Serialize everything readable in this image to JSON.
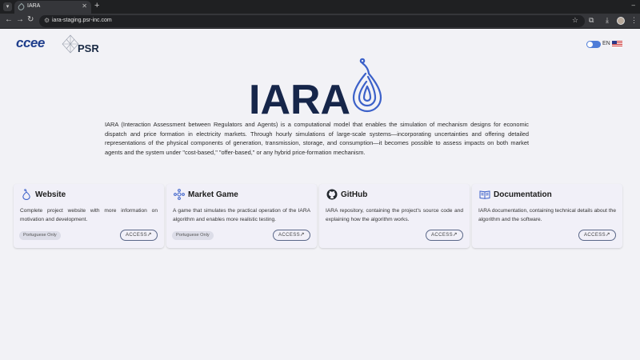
{
  "browser": {
    "tab_title": "IARA",
    "url": "iara-staging.psr-inc.com",
    "tab_close": "✕",
    "new_tab": "+",
    "menu": "⋮"
  },
  "header": {
    "ccee_logo": "ccee",
    "psr_logo": "PSR",
    "language": "EN"
  },
  "hero": {
    "logo_text": "IARA",
    "description": "IARA (Interaction Assessment between Regulators and Agents) is a computational model that enables the simulation of mechanism designs for economic dispatch and price formation in electricity markets. Through hourly simulations of large-scale systems—incorporating uncertainties and offering detailed representations of the physical components of generation, transmission, storage, and consumption—it becomes possible to assess impacts on both market agents and the system under \"cost-based,\" \"offer-based,\" or any hybrid price-formation mechanism."
  },
  "cards": [
    {
      "title": "Website",
      "icon": "drop-icon",
      "description": "Complete project website with more information on motivation and development.",
      "badge": "Portuguese Only",
      "action": "ACCESS"
    },
    {
      "title": "Market Game",
      "icon": "molecule-icon",
      "description": "A game that simulates the practical operation of the IARA algorithm and enables more realistic testing.",
      "badge": "Portuguese Only",
      "action": "ACCESS"
    },
    {
      "title": "GitHub",
      "icon": "github-icon",
      "description": "IARA repository, containing the project's source code and explaining how the algorithm works.",
      "badge": "",
      "action": "ACCESS"
    },
    {
      "title": "Documentation",
      "icon": "book-icon",
      "description": "IARA documentation, containing technical details about the algorithm and the software.",
      "badge": "",
      "action": "ACCESS"
    }
  ],
  "colors": {
    "navy": "#16264a",
    "accent_blue": "#4f7dd8",
    "card_bg": "#f1f0f8"
  }
}
